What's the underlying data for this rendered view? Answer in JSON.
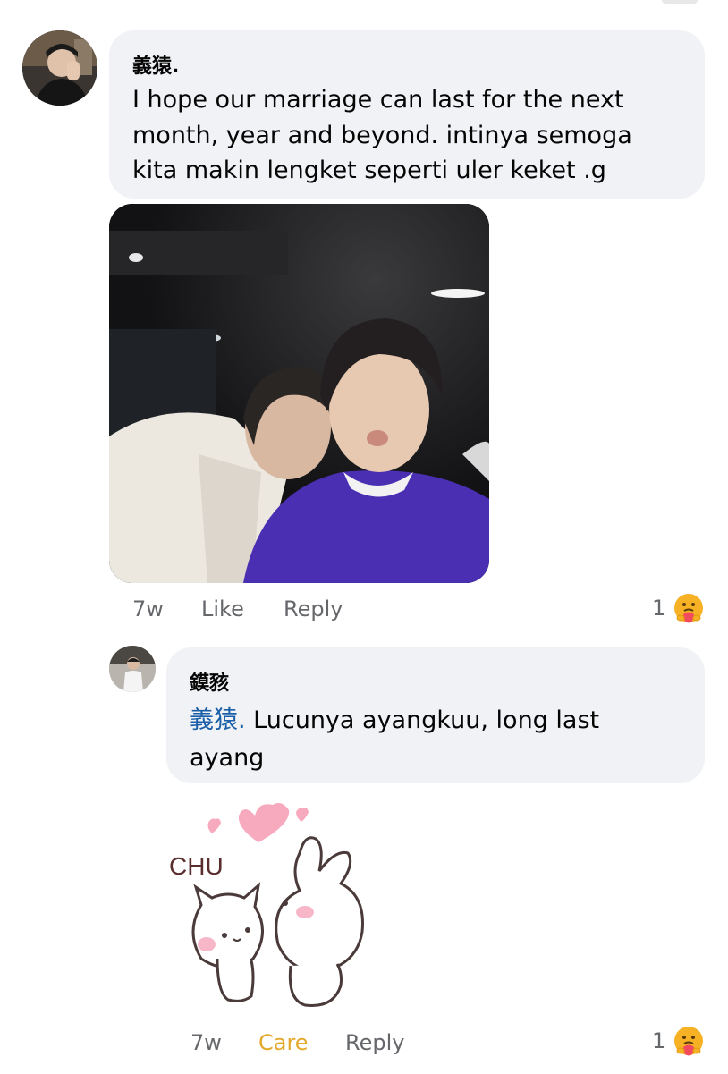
{
  "comment": {
    "author": "義猿.",
    "text_lines": [
      "I hope our marriage can last for the next",
      "month, year and beyond. intinya semoga",
      "kita makin lengket seperti uler keket .g"
    ],
    "time": "7w",
    "like_label": "Like",
    "reply_label": "Reply",
    "reaction_count": "1",
    "reaction_icon": "care-hug-emoji"
  },
  "reply": {
    "author": "鏌豥",
    "mention": "義猿.",
    "text_line1": " Lucunya ayangkuu, long last",
    "text_line2": "ayang",
    "time": "7w",
    "care_label": "Care",
    "reply_label": "Reply",
    "reaction_count": "1",
    "reaction_icon": "care-hug-emoji",
    "sticker_text": "CHU"
  },
  "colors": {
    "bubble": "#f0f2f5",
    "meta_text": "#65676b",
    "mention": "#1a5fa8",
    "care": "#e4a82b"
  }
}
